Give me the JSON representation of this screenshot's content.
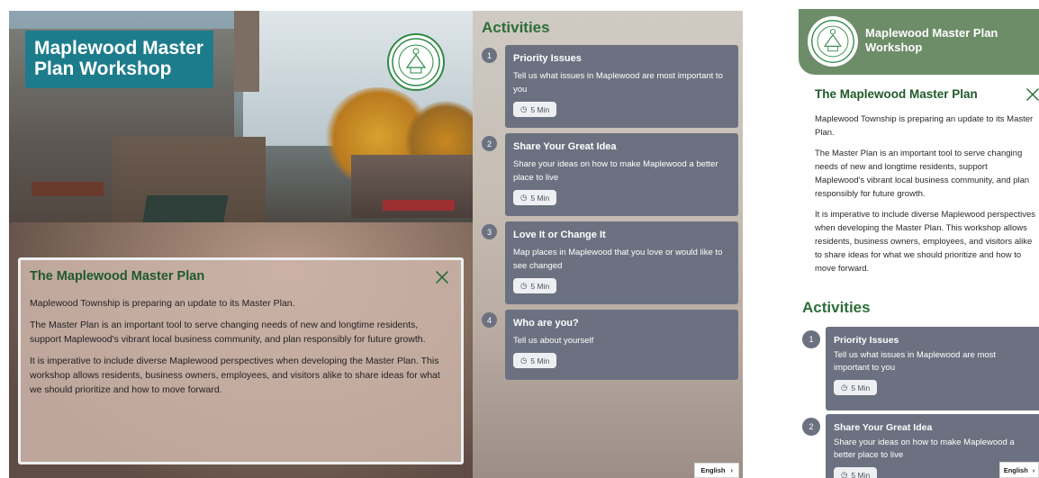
{
  "desktop": {
    "hero_title": "Maplewood Master Plan Workshop",
    "seal_icon": "township-seal-icon",
    "info_panel": {
      "title": "The Maplewood Master Plan",
      "paragraphs": [
        "Maplewood Township is preparing an update to its Master Plan.",
        "The Master Plan is an important tool to serve changing needs of new and longtime residents, support Maplewood's vibrant local business community, and plan responsibly for future growth.",
        "It is imperative to include diverse Maplewood perspectives when developing the Master Plan. This workshop allows residents, business owners, employees, and visitors alike to share ideas for what we should prioritize and how to move forward."
      ]
    },
    "activities_heading": "Activities",
    "activities": [
      {
        "num": "1",
        "title": "Priority Issues",
        "desc": "Tell us what issues in Maplewood are most important to you",
        "duration": "5 Min"
      },
      {
        "num": "2",
        "title": "Share Your Great Idea",
        "desc": "Share your ideas on how to make Maplewood a better place to live",
        "duration": "5 Min"
      },
      {
        "num": "3",
        "title": "Love It or Change It",
        "desc": "Map places in Maplewood that you love or would like to see changed",
        "duration": "5 Min"
      },
      {
        "num": "4",
        "title": "Who are you?",
        "desc": "Tell us about yourself",
        "duration": "5 Min"
      }
    ],
    "language": "English",
    "language_chevron": "›"
  },
  "mobile": {
    "header_title": "Maplewood Master Plan Workshop",
    "section_title": "The Maplewood Master Plan",
    "paragraphs": [
      "Maplewood Township is preparing an update to its Master Plan.",
      "The Master Plan is an important tool to serve changing needs of new and longtime residents, support Maplewood's vibrant local business community, and plan responsibly for future growth.",
      "It is imperative to include diverse Maplewood perspectives when developing the Master Plan. This workshop allows residents, business owners, employees, and visitors alike to share ideas for what we should prioritize and how to move forward."
    ],
    "activities_heading": "Activities",
    "activities": [
      {
        "num": "1",
        "title": "Priority Issues",
        "desc": "Tell us what issues in Maplewood are most important to you",
        "duration": "5 Min"
      },
      {
        "num": "2",
        "title": "Share Your Great Idea",
        "desc": "Share your ideas on how to make Maplewood a better place to live",
        "duration": "5 Min"
      }
    ],
    "language": "English",
    "language_chevron": "›"
  },
  "colors": {
    "teal_banner": "#1d7c8c",
    "green_heading": "#2d6e38",
    "card_gray": "#6b7180",
    "mobile_header_green": "#6d8c68"
  }
}
